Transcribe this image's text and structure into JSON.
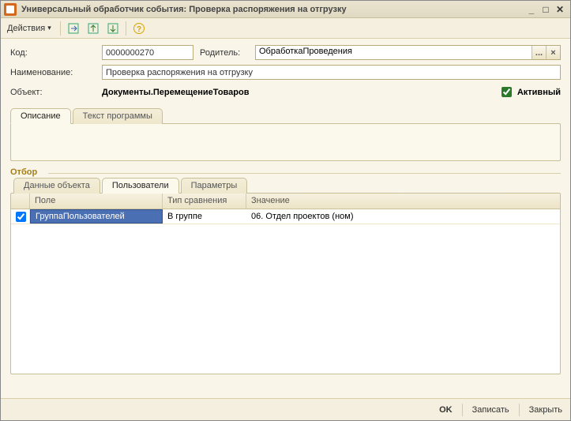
{
  "window": {
    "title": "Универсальный обработчик события: Проверка распоряжения на отгрузку"
  },
  "toolbar": {
    "actions_label": "Действия"
  },
  "form": {
    "code_label": "Код:",
    "code_value": "0000000270",
    "parent_label": "Родитель:",
    "parent_value": "ОбработкаПроведения",
    "name_label": "Наименование:",
    "name_value": "Проверка распоряжения на отгрузку",
    "object_label": "Объект:",
    "object_value": "Документы.ПеремещениеТоваров",
    "active_label": "Активный",
    "active_checked": true
  },
  "tabs_main": [
    "Описание",
    "Текст программы"
  ],
  "otbor_label": "Отбор",
  "tabs_filter": [
    "Данные объекта",
    "Пользователи",
    "Параметры"
  ],
  "grid": {
    "columns": [
      "",
      "Поле",
      "Тип сравнения",
      "Значение"
    ],
    "rows": [
      {
        "checked": true,
        "field": "ГруппаПользователей",
        "cmp": "В группе",
        "value": "06. Отдел проектов (ном)"
      }
    ]
  },
  "footer": {
    "ok": "OK",
    "save": "Записать",
    "close": "Закрыть"
  }
}
